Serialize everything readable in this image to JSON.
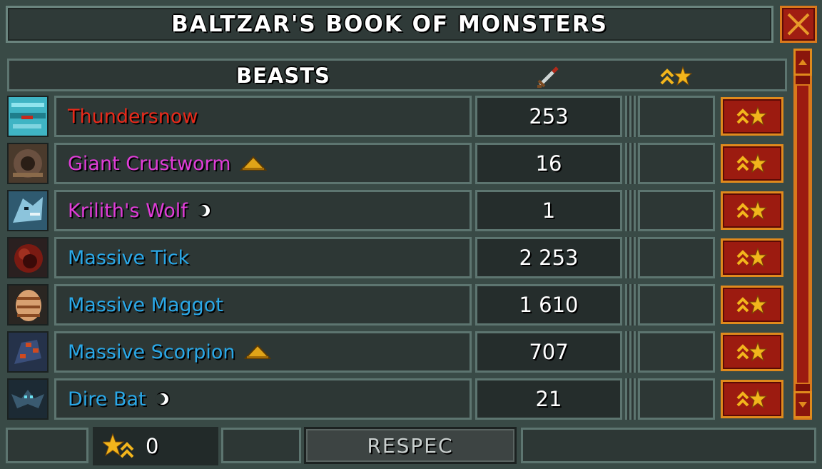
{
  "window": {
    "title": "BALTZAR'S BOOK OF MONSTERS"
  },
  "table": {
    "category_header": "BEASTS",
    "sword_column_icon": "sword-icon",
    "star_column_icon": "chevron-star-icon"
  },
  "rows": [
    {
      "name": "Thundersnow",
      "color": "#e8291a",
      "value": "253",
      "badge": "",
      "portrait": "frost-beast"
    },
    {
      "name": "Giant Crustworm",
      "color": "#e03cd8",
      "value": "16",
      "badge": "triangle",
      "portrait": "crustworm"
    },
    {
      "name": "Krilith's Wolf",
      "color": "#e03cd8",
      "value": "1",
      "badge": "moon",
      "portrait": "ice-wolf"
    },
    {
      "name": "Massive Tick",
      "color": "#2aa8e8",
      "value": "2 253",
      "badge": "",
      "portrait": "tick"
    },
    {
      "name": "Massive Maggot",
      "color": "#2aa8e8",
      "value": "1 610",
      "badge": "",
      "portrait": "maggot"
    },
    {
      "name": "Massive Scorpion",
      "color": "#2aa8e8",
      "value": "707",
      "badge": "triangle",
      "portrait": "scorpion"
    },
    {
      "name": "Dire Bat",
      "color": "#2aa8e8",
      "value": "21",
      "badge": "moon",
      "portrait": "bat"
    }
  ],
  "footer": {
    "points": "0",
    "respec_label": "RESPEC"
  },
  "colors": {
    "accent_red": "#9c1b10",
    "accent_orange": "#e08a1c",
    "frame": "#5d7570"
  }
}
